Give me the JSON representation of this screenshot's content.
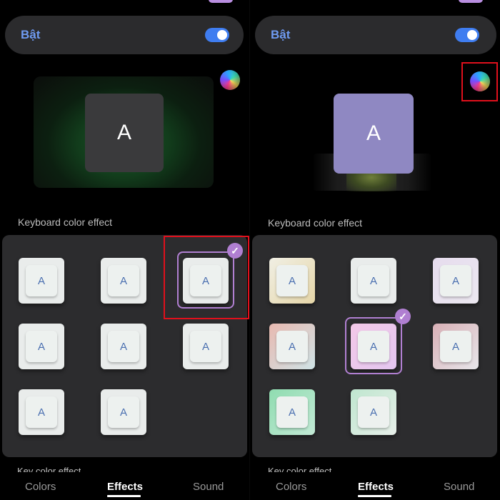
{
  "toggle": {
    "label": "Bật",
    "state": "on"
  },
  "accent_colors": {
    "toggle": "#3f7df0",
    "selection": "#b07fd1",
    "highlight_box": "#e0101c"
  },
  "preview": {
    "key_label": "A"
  },
  "section": {
    "keyboard_color_effect": "Keyboard color effect",
    "key_color_effect": "Key color effect"
  },
  "left_grid": {
    "selected_index": 2,
    "tiles": [
      "A",
      "A",
      "A",
      "A",
      "A",
      "A",
      "A",
      "A"
    ]
  },
  "right_grid": {
    "selected_index": 4,
    "tiles": [
      "A",
      "A",
      "A",
      "A",
      "A",
      "A",
      "A",
      "A"
    ]
  },
  "tabs": [
    {
      "label": "Colors",
      "active": false
    },
    {
      "label": "Effects",
      "active": true
    },
    {
      "label": "Sound",
      "active": false
    }
  ],
  "icons": {
    "palette": "color-palette-icon",
    "check": "check-icon"
  }
}
